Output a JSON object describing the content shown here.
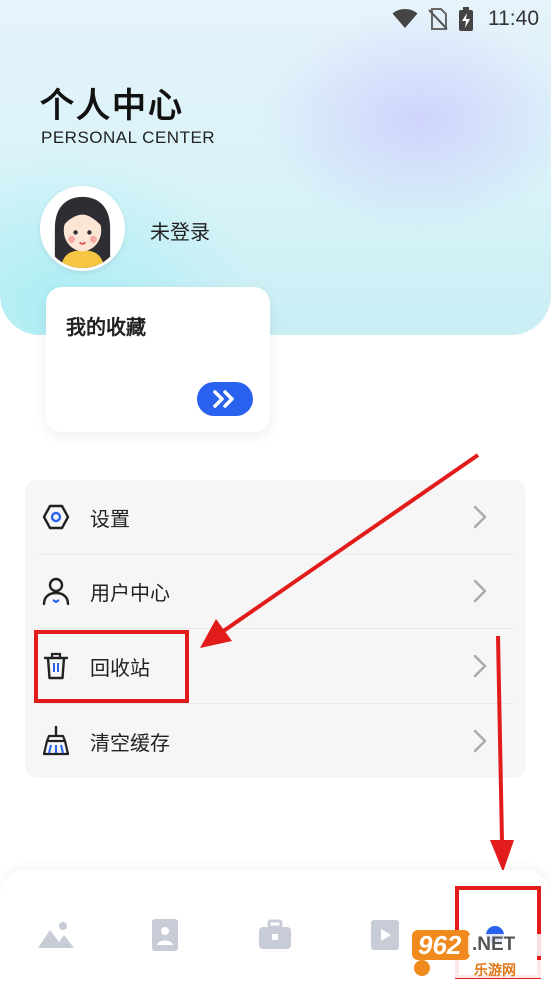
{
  "status_bar": {
    "time": "11:40"
  },
  "header": {
    "title": "个人中心",
    "subtitle": "PERSONAL CENTER"
  },
  "profile": {
    "login_status": "未登录"
  },
  "favorites": {
    "title": "我的收藏"
  },
  "menu": {
    "items": [
      {
        "label": "设置",
        "icon": "settings-hexagon-icon"
      },
      {
        "label": "用户中心",
        "icon": "user-icon"
      },
      {
        "label": "回收站",
        "icon": "trash-icon"
      },
      {
        "label": "清空缓存",
        "icon": "broom-icon"
      }
    ]
  },
  "tabbar": {
    "tabs": [
      "image-mountain-icon",
      "photo-card-icon",
      "toolbox-icon",
      "video-icon",
      "profile-dot-icon"
    ],
    "active_index": 4
  },
  "watermark": {
    "brand": "962",
    "net": ".NET",
    "site": "乐游网"
  },
  "colors": {
    "accent": "#2a62f0",
    "annotation": "#e21b1b",
    "menu_bg": "#f6f6f7"
  }
}
